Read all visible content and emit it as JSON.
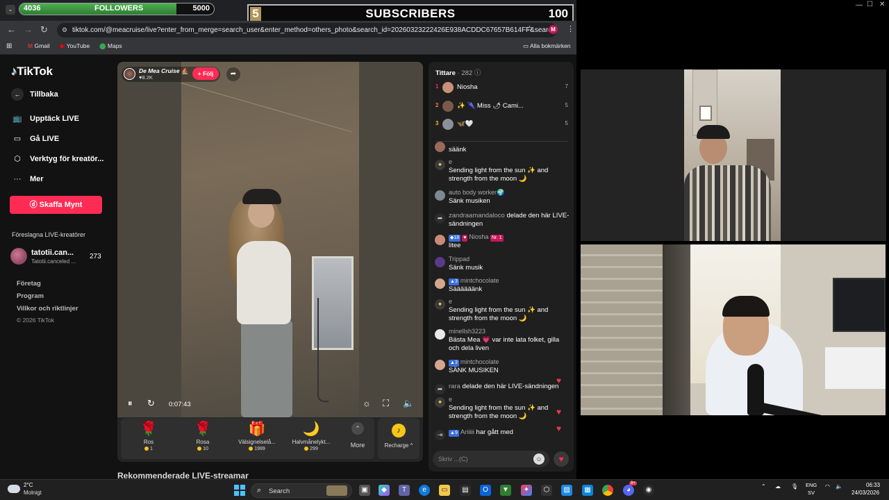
{
  "overlays": {
    "followers": {
      "current": "4036",
      "label": "FOLLOWERS",
      "goal": "5000",
      "progress_fraction": 0.807
    },
    "subscribers": {
      "current": "5",
      "label": "SUBSCRIBERS",
      "goal": "100"
    }
  },
  "browser": {
    "url": "tiktok.com/@meacruise/live?enter_from_merge=search_user&enter_method=others_photo&search_id=20260323222426E938ACDDC67657B614FF&search...",
    "profile_initial": "M",
    "bookmarks": [
      "Gmail",
      "YouTube",
      "Maps"
    ],
    "all_bookmarks": "Alla bokmärken"
  },
  "sidebar": {
    "logo": "TikTok",
    "back": "Tillbaka",
    "items": [
      {
        "icon": "live-tv-icon",
        "label": "Upptäck LIVE"
      },
      {
        "icon": "camera-icon",
        "label": "Gå LIVE"
      },
      {
        "icon": "creator-tools-icon",
        "label": "Verktyg för kreatör..."
      },
      {
        "icon": "more-dots-icon",
        "label": "Mer"
      }
    ],
    "coins_button": "Skaffa Mynt",
    "suggested_title": "Föreslagna LIVE-kreatörer",
    "suggested": {
      "name": "tatotii.can...",
      "sub": "Tatotii.canceled ...",
      "count": "273"
    },
    "footer": [
      "Företag",
      "Program",
      "Villkor och riktlinjer"
    ],
    "copyright": "© 2026 TikTok"
  },
  "video": {
    "host_name": "De Mea Cruise",
    "host_likes": "8.2K",
    "follow_label": "+ Följ",
    "time": "0:07:43",
    "gifts": [
      {
        "icon": "rose-icon",
        "glyph": "🌹",
        "name": "Ros",
        "price": "1"
      },
      {
        "icon": "rose-icon",
        "glyph": "🌹",
        "name": "Rosa",
        "price": "10"
      },
      {
        "icon": "treasure-icon",
        "glyph": "🎁",
        "name": "Välsignelselå...",
        "price": "1999"
      },
      {
        "icon": "crescent-moon-icon",
        "glyph": "🌙",
        "name": "Halvmånelykt...",
        "price": "299"
      }
    ],
    "more_label": "More",
    "recharge_label": "Recharge ^"
  },
  "recommended_title": "Rekommenderade LIVE-streamar",
  "chat": {
    "viewers_label": "Tittare",
    "viewer_count": "· 282",
    "ranking": [
      {
        "rank": "1",
        "name": "Niosha",
        "score": "7"
      },
      {
        "rank": "2",
        "name": "✨ 🌂 Miss 🌶 Cami...",
        "score": "5"
      },
      {
        "rank": "3",
        "name": "🦋🤍",
        "score": "5"
      }
    ],
    "messages": [
      {
        "user": "",
        "text": "säänk"
      },
      {
        "user": "e",
        "text": "Sending light from the sun ✨ and strength from the moon 🌙"
      },
      {
        "user": "auto body worker🌍",
        "text": "Sänk musiken"
      },
      {
        "user": "zandraamandaloco",
        "text": "delade den här LIVE-sändningen"
      },
      {
        "user": "Niosha",
        "badge": "18",
        "badge2": "Nr. 1",
        "text": "litee"
      },
      {
        "user": "Trippad",
        "text": "Sänk musik"
      },
      {
        "user": "mintchocolate",
        "badge": "3",
        "text": "Säääääänk"
      },
      {
        "user": "e",
        "text": "Sending light from the sun ✨ and strength from the moon 🌙"
      },
      {
        "user": "minellsh3223",
        "text": "Bästa Mea 💗 var inte lata folket, gilla och dela liven"
      },
      {
        "user": "mintchocolate",
        "badge": "3",
        "text": "SÄNK MUSIKEN"
      },
      {
        "user": "rara",
        "text": "delade den här LIVE-sändningen"
      },
      {
        "user": "e",
        "text": "Sending light from the sun ✨ and strength from the moon 🌙"
      },
      {
        "user": "Ariiiii",
        "badge": "9",
        "text": "har gått med"
      }
    ],
    "input_placeholder": "Skriv ...(C)"
  },
  "taskbar": {
    "weather_temp": "2°C",
    "weather_desc": "Molnigt",
    "search": "Search",
    "lang": "ENG",
    "lang_sub": "SV",
    "time": "06:33",
    "date": "24/03/2026",
    "notif_count": "9+"
  }
}
